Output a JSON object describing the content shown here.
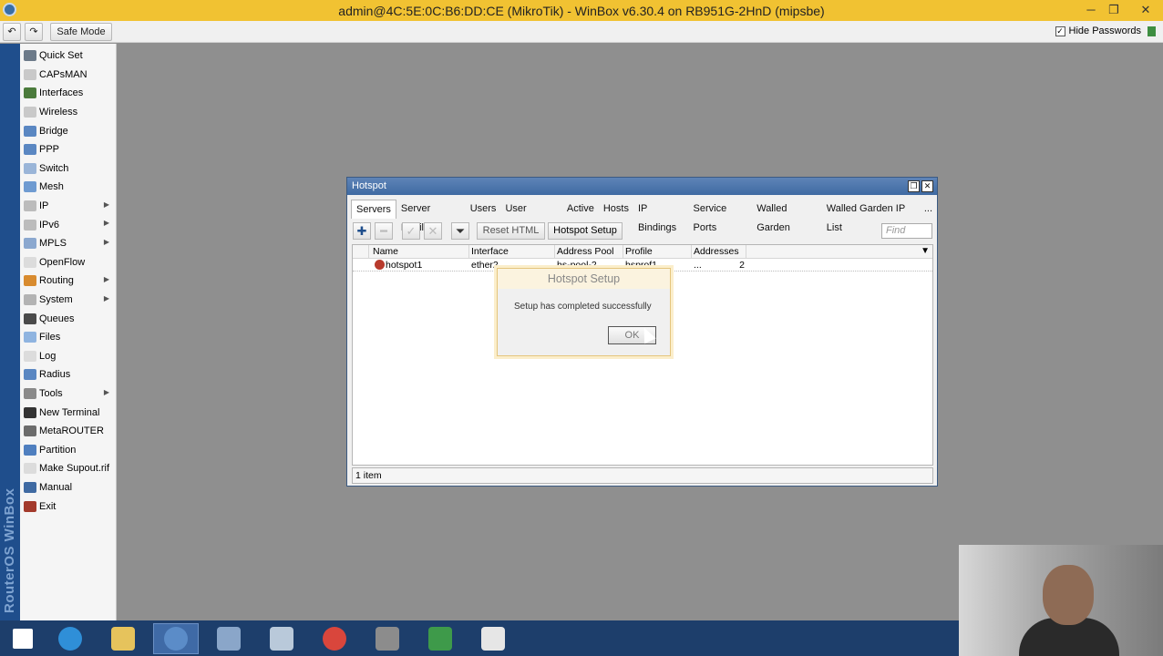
{
  "window": {
    "title": "admin@4C:5E:0C:B6:DD:CE (MikroTik) - WinBox v6.30.4 on RB951G-2HnD (mipsbe)",
    "minimize_glyph": "─",
    "maximize_glyph": "❐",
    "close_glyph": "✕"
  },
  "toolbar": {
    "undo_glyph": "↶",
    "redo_glyph": "↷",
    "safe_mode_label": "Safe Mode",
    "hide_passwords_label": "Hide Passwords",
    "hide_passwords_checked_glyph": "✓",
    "brand_color": "#3e8e41"
  },
  "sidebar": {
    "brand_text": "RouterOS WinBox",
    "items": [
      {
        "label": "Quick Set",
        "icon": "quick-set-icon",
        "color": "#6c7a89",
        "submenu": false
      },
      {
        "label": "CAPsMAN",
        "icon": "capsman-icon",
        "color": "#c9c9c9",
        "submenu": false
      },
      {
        "label": "Interfaces",
        "icon": "interfaces-icon",
        "color": "#4b7b3c",
        "submenu": false
      },
      {
        "label": "Wireless",
        "icon": "wireless-icon",
        "color": "#c9c9c9",
        "submenu": false
      },
      {
        "label": "Bridge",
        "icon": "bridge-icon",
        "color": "#5a87c2",
        "submenu": false
      },
      {
        "label": "PPP",
        "icon": "ppp-icon",
        "color": "#5a87c2",
        "submenu": false
      },
      {
        "label": "Switch",
        "icon": "switch-icon",
        "color": "#9ab5d8",
        "submenu": false
      },
      {
        "label": "Mesh",
        "icon": "mesh-icon",
        "color": "#6f9bd1",
        "submenu": false
      },
      {
        "label": "IP",
        "icon": "ip-icon",
        "color": "#bcbcbc",
        "submenu": true
      },
      {
        "label": "IPv6",
        "icon": "ipv6-icon",
        "color": "#bcbcbc",
        "submenu": true
      },
      {
        "label": "MPLS",
        "icon": "mpls-icon",
        "color": "#8ba8cf",
        "submenu": true
      },
      {
        "label": "OpenFlow",
        "icon": "openflow-icon",
        "color": "#dcdcdc",
        "submenu": false
      },
      {
        "label": "Routing",
        "icon": "routing-icon",
        "color": "#d88b2f",
        "submenu": true
      },
      {
        "label": "System",
        "icon": "system-icon",
        "color": "#b3b3b3",
        "submenu": true
      },
      {
        "label": "Queues",
        "icon": "queues-icon",
        "color": "#4a4a4a",
        "submenu": false
      },
      {
        "label": "Files",
        "icon": "files-icon",
        "color": "#8fb4e0",
        "submenu": false
      },
      {
        "label": "Log",
        "icon": "log-icon",
        "color": "#dcdcdc",
        "submenu": false
      },
      {
        "label": "Radius",
        "icon": "radius-icon",
        "color": "#5a87c2",
        "submenu": false
      },
      {
        "label": "Tools",
        "icon": "tools-icon",
        "color": "#8a8a8a",
        "submenu": true
      },
      {
        "label": "New Terminal",
        "icon": "terminal-icon",
        "color": "#333333",
        "submenu": false
      },
      {
        "label": "MetaROUTER",
        "icon": "metarouter-icon",
        "color": "#6c6c6c",
        "submenu": false
      },
      {
        "label": "Partition",
        "icon": "partition-icon",
        "color": "#4f7fbf",
        "submenu": false
      },
      {
        "label": "Make Supout.rif",
        "icon": "supout-icon",
        "color": "#dcdcdc",
        "submenu": false
      },
      {
        "label": "Manual",
        "icon": "manual-icon",
        "color": "#3f6aa2",
        "submenu": false
      },
      {
        "label": "Exit",
        "icon": "exit-icon",
        "color": "#a33a2c",
        "submenu": false
      }
    ],
    "submenu_glyph": "▶"
  },
  "hotspot": {
    "title": "Hotspot",
    "restore_glyph": "❐",
    "close_glyph": "✕",
    "tabs": [
      "Servers",
      "Server Profiles",
      "Users",
      "User Profiles",
      "Active",
      "Hosts",
      "IP Bindings",
      "Service Ports",
      "Walled Garden",
      "Walled Garden IP List",
      "..."
    ],
    "active_tab": "Servers",
    "toolbar": {
      "add_glyph": "✚",
      "remove_glyph": "━",
      "enable_glyph": "✓",
      "disable_glyph": "✕",
      "filter_glyph": "⏷",
      "reset_html_label": "Reset HTML",
      "hotspot_setup_label": "Hotspot Setup",
      "find_placeholder": "Find"
    },
    "columns": [
      "Name",
      "Interface",
      "Address Pool",
      "Profile",
      "Addresses ..."
    ],
    "dropdown_glyph": "▼",
    "rows": [
      {
        "name": "hotspot1",
        "interface": "ether2",
        "address_pool": "hs-pool-2",
        "profile": "hsprof1",
        "addresses": "2"
      }
    ],
    "status": "1 item"
  },
  "dialog": {
    "title": "Hotspot Setup",
    "message": "Setup has completed successfully",
    "ok_label": "OK"
  },
  "taskbar": {
    "items": [
      {
        "icon": "windows-start-icon",
        "color": "#ffffff",
        "active": false
      },
      {
        "icon": "internet-explorer-icon",
        "color": "#2f8fd8",
        "active": false
      },
      {
        "icon": "file-explorer-icon",
        "color": "#e6c35c",
        "active": false
      },
      {
        "icon": "winbox-icon",
        "color": "#5b8cc8",
        "active": true
      },
      {
        "icon": "remote-desktop-icon",
        "color": "#8aa6c9",
        "active": false
      },
      {
        "icon": "calculator-icon",
        "color": "#b9c9da",
        "active": false
      },
      {
        "icon": "chrome-icon",
        "color": "#d9463c",
        "active": false
      },
      {
        "icon": "app-grid-icon",
        "color": "#8c8c8c",
        "active": false
      },
      {
        "icon": "camtasia-recorder-icon",
        "color": "#3e9a4a",
        "active": false
      },
      {
        "icon": "camtasia-studio-icon",
        "color": "#e6e6e6",
        "active": false
      }
    ]
  }
}
